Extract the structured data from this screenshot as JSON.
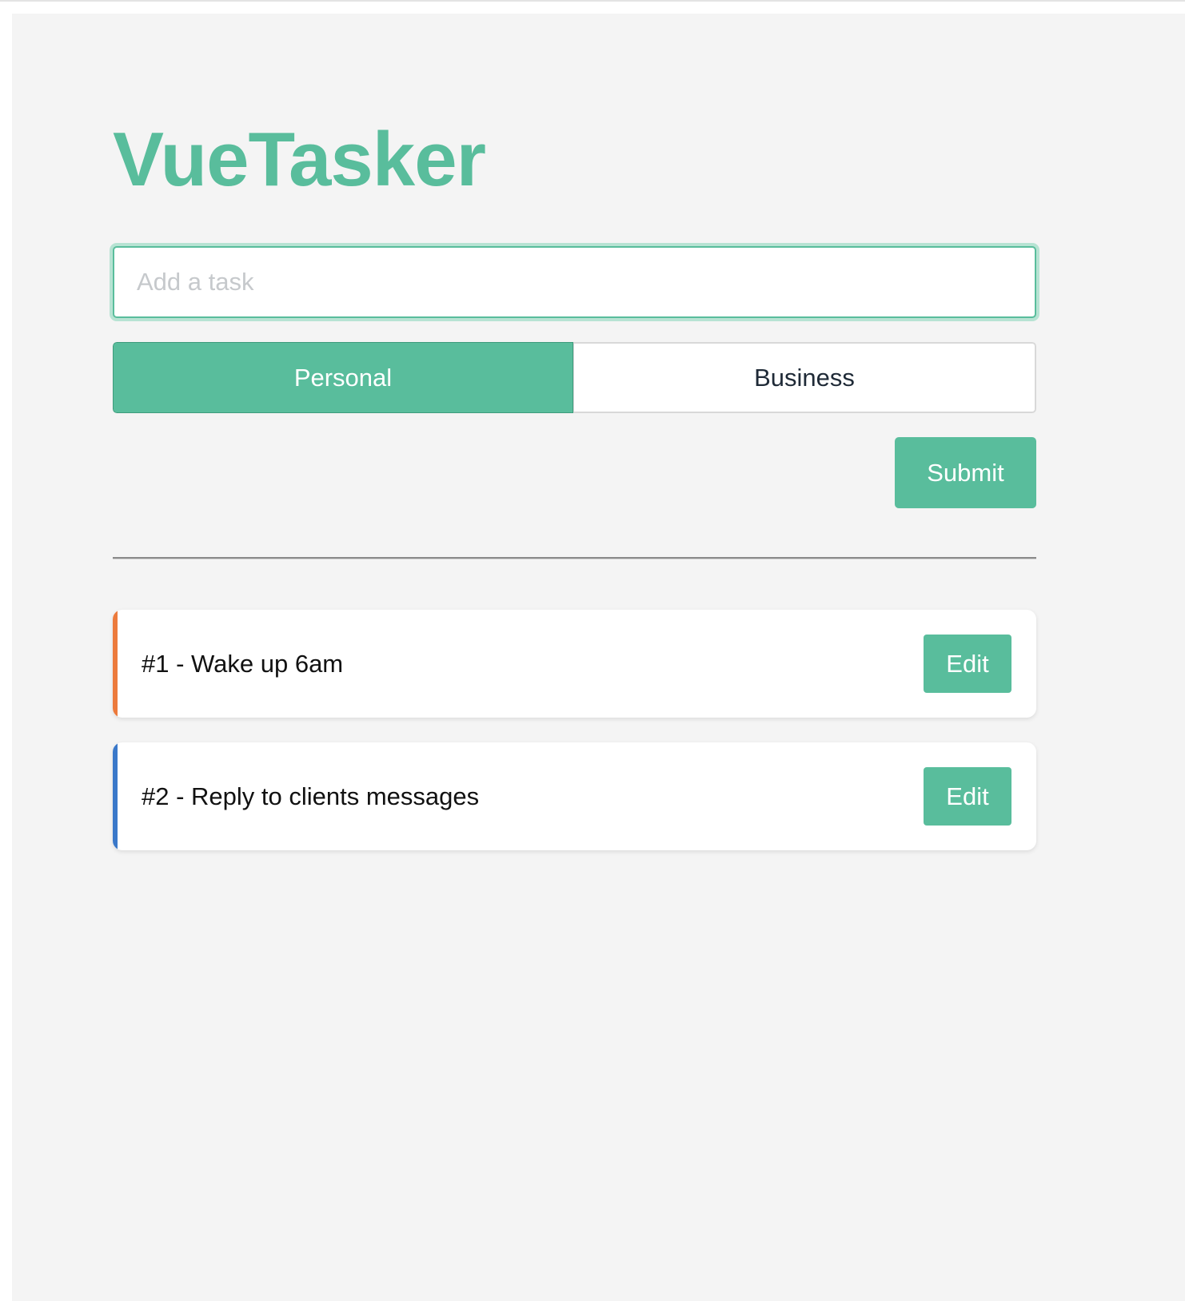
{
  "app": {
    "title": "VueTasker"
  },
  "task_form": {
    "input_value": "",
    "input_placeholder": "Add a task",
    "category_options": [
      "Personal",
      "Business"
    ],
    "selected_category": "Personal",
    "submit_label": "Submit"
  },
  "tasks": [
    {
      "text": "#1 - Wake up 6am",
      "category": "Personal",
      "accent_color": "#ec7a3c",
      "edit_label": "Edit"
    },
    {
      "text": "#2 - Reply to clients messages",
      "category": "Business",
      "accent_color": "#3a78c9",
      "edit_label": "Edit"
    }
  ],
  "colors": {
    "brand": "#59bd9c",
    "background": "#f4f4f4",
    "personal_accent": "#ec7a3c",
    "business_accent": "#3a78c9"
  }
}
